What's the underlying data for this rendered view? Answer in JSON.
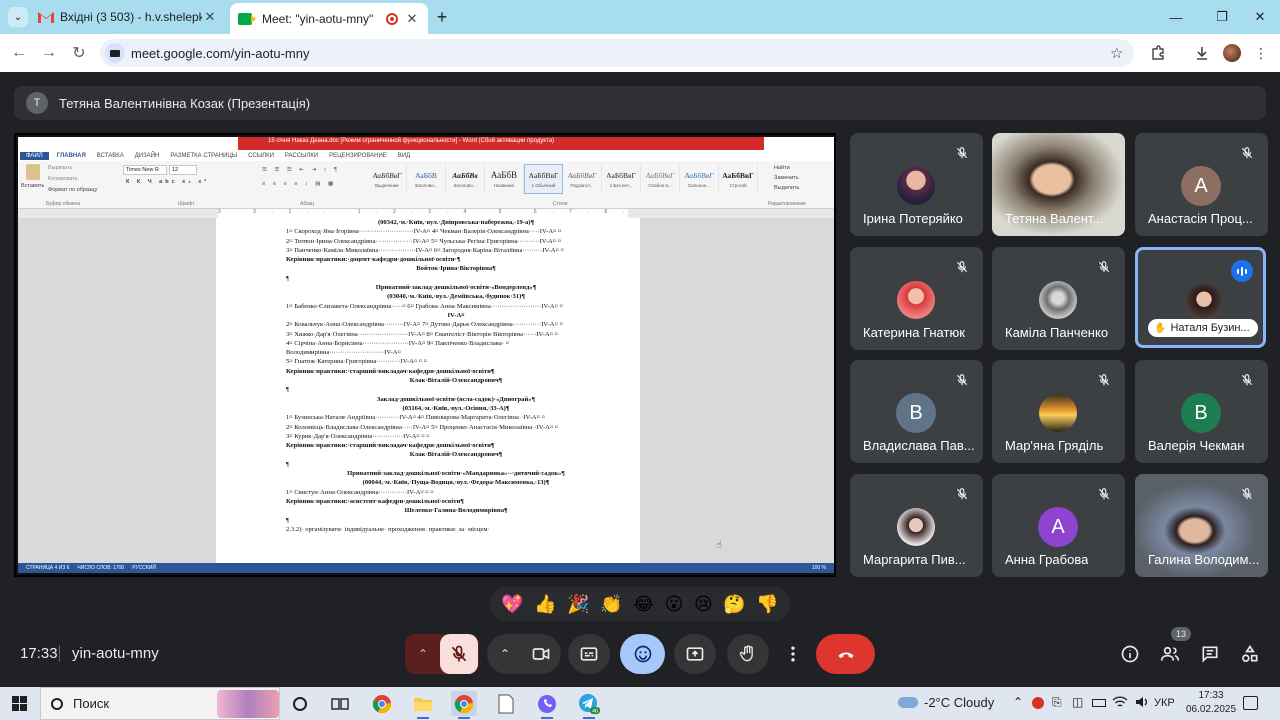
{
  "browser": {
    "tabs": [
      {
        "title": "Вхідні (3 503) - h.v.shelepko@u",
        "active": false,
        "icon": "gmail-icon"
      },
      {
        "title": "Meet: \"yin-aotu-mny\"",
        "active": true,
        "icon": "meet-icon"
      }
    ],
    "url": "meet.google.com/yin-aotu-mny"
  },
  "meet": {
    "presenter_initial": "Т",
    "presenter_label": "Тетяна Валентинівна Козак (Презентація)",
    "time": "17:33",
    "meeting_code": "yin-aotu-mny",
    "participant_count": "13",
    "reactions": [
      "💖",
      "👍",
      "🎉",
      "👏",
      "😂",
      "😮",
      "😢",
      "🤔",
      "👎"
    ],
    "participants": [
      {
        "name": "Ірина Потеряйко",
        "type": "photo",
        "muted": true
      },
      {
        "name": "Тетяна Валент...",
        "type": "video",
        "muted": false
      },
      {
        "name": "Анастасія Проц...",
        "type": "initial",
        "initial": "А",
        "color": "#8d6e63",
        "muted": true
      },
      {
        "name": "Катерина Гнатюк",
        "type": "photo",
        "muted": true
      },
      {
        "name": "Каміла Панченко",
        "type": "photo",
        "muted": true
      },
      {
        "name": "Наталя Бузин...",
        "type": "photo",
        "muted": false,
        "speaking": true
      },
      {
        "name": "Владислава Пав...",
        "type": "initial",
        "initial": "В",
        "color": "#5f7486",
        "muted": true
      },
      {
        "name": "Мар'яна Гряділь",
        "type": "photo",
        "muted": true
      },
      {
        "name": "Валерія Чекман",
        "type": "initial",
        "initial": "В",
        "color": "#1e7d4f",
        "muted": true
      },
      {
        "name": "Маргарита Пив...",
        "type": "photo",
        "muted": true
      },
      {
        "name": "Анна Грабова",
        "type": "initial",
        "initial": "А",
        "color": "#8e44d0",
        "muted": true
      },
      {
        "name": "Галина Володим...",
        "type": "video",
        "muted": true
      }
    ]
  },
  "word": {
    "doc_title": "15 січня Наказ Деана.doc [Режим ограниченной функциональности] - Word (Сбой активации продукта)",
    "tabs": [
      "ФАЙЛ",
      "ГЛАВНАЯ",
      "ВСТАВКА",
      "ДИЗАЙН",
      "РАЗМЕТКА СТРАНИЦЫ",
      "ССЫЛКИ",
      "РАССЫЛКИ",
      "РЕЦЕНЗИРОВАНИЕ",
      "ВИД"
    ],
    "clipboard": {
      "paste": "Вставить",
      "cut": "Вырезать",
      "copy": "Копировать",
      "format": "Формат по образцу",
      "group": "Буфер обмена"
    },
    "font_name": "Times New R",
    "font_size": "12",
    "group_font": "Шрифт",
    "group_paragraph": "Абзац",
    "group_styles": "Стили",
    "group_editing": "Редактирование",
    "editing": [
      "Найти",
      "Заменить",
      "Выделить"
    ],
    "styles": [
      {
        "sample": "АаБбВвГ",
        "name": "Выделение"
      },
      {
        "sample": "АаБбВ",
        "name": "Заголово..."
      },
      {
        "sample": "АаБбВв",
        "name": "Заголово..."
      },
      {
        "sample": "АаБбВ",
        "name": "Название"
      },
      {
        "sample": "АаБбВвГ",
        "name": "1 Обычный"
      },
      {
        "sample": "АаБбВвГ",
        "name": "Подзагол..."
      },
      {
        "sample": "АаБбВвГ",
        "name": "1 Без инт..."
      },
      {
        "sample": "АаБбВвГ",
        "name": "Слабое в..."
      },
      {
        "sample": "АаБбВвГ",
        "name": "Сильное..."
      },
      {
        "sample": "АаБбВвГ",
        "name": "Строгий"
      }
    ],
    "ruler": "3 · 2 · 1 · · · 1 · 2 · 3 · 4 · 5 · 6 · 7 · 8 · 9 · 10 · 11 · 12 · 13 · 14 · 15 · 16 · 17",
    "doc_lines": [
      {
        "t": "(00342,·м.·Київ,·вул.·Дніпровська·набережна,·19-а)¶",
        "s": "c"
      },
      {
        "t": "1¤  Скороход·Яна·Ігорівна·························IV-А¤    4¤   Чекман·Валерія·Олександрівна·····IV-А¤ ¤",
        "s": ""
      },
      {
        "t": "2¤  Тютюн·Ірина·Олександрівна·················IV-А¤    5¤   Чульська·Регіна·Григорівна··········IV-А¤ ¤",
        "s": ""
      },
      {
        "t": "3¤  Панченко·Каміла·Миколаївна·················IV-А¤    6¤   Загородня·Каріна·Віталіївна·········IV-А¤ ¤",
        "s": ""
      },
      {
        "t": "Керівник·практики:·доцент·кафедри·дошкільної·освіти·¶",
        "s": "b"
      },
      {
        "t": "Войток·Ірина·Вікторівна¶",
        "s": "c"
      },
      {
        "t": "¶",
        "s": ""
      },
      {
        "t": "Приватний·заклад·дошкільної·освіти·«Вондерленд»¶",
        "s": "c"
      },
      {
        "t": "(03040,·м.·Київ,·вул.·Деміївська,·будинок·31)¶",
        "s": "c"
      },
      {
        "t": "1¤  Бабенко·Єлизавета·Олександрівна·····¤    6¤   Грабова·Анна·Максимівна·······················IV-А¤ ¤",
        "s": ""
      },
      {
        "t": "IV-А¤",
        "s": "c"
      },
      {
        "t": "2¤  Ковальчук·Анна·Олександрівна·········IV-А¤    7¤   Дутова·Дарья·Олександрівна·············IV-А¤ ¤",
        "s": ""
      },
      {
        "t": "3¤  Хижко·Дар'я·Олегівна·······················IV-А¤    8¤   Євангеліст·Вікторія·Вікторівна······IV-А¤ ¤",
        "s": ""
      },
      {
        "t": "4¤  Сірчіна·Анна·Борисівна·····················IV-А¤    9¤   Павліченко·Владислава·                          ¤",
        "s": ""
      },
      {
        "t": "                                                                     Володимирівна·························IV-А¤",
        "s": ""
      },
      {
        "t": "5¤  Гнатюк·Катерина·Григорівна···········IV-А¤   ¤        ¤",
        "s": ""
      },
      {
        "t": "Керівник·практики:·старший·викладач·кафедри·дошкільної·освіти¶",
        "s": "b"
      },
      {
        "t": "Клак·Віталій·Олександрович¶",
        "s": "c"
      },
      {
        "t": "¶",
        "s": ""
      },
      {
        "t": "Заклад·дошкільної·освіти·(ясла-садок)·«Двиограй»¶",
        "s": "c"
      },
      {
        "t": "(03164,·м.·Київ,·вул.·Осіння,·33-А)¶",
        "s": "c"
      },
      {
        "t": "1¤  Бузинська·Наталя·Андріївна···········IV-А¤    4¤   Пивоварова·Маргарита·Олегівна··IV-А¤ ¤",
        "s": ""
      },
      {
        "t": "2¤  Коломієць·Владислава·Олександрівна·····IV-А¤    5¤   Проценко·Анастасія·Миколаївна··IV-А¤ ¤",
        "s": ""
      },
      {
        "t": "3¤  Курик·Дар'я·Олександрівна··············IV-А¤   ¤        ¤",
        "s": ""
      },
      {
        "t": "Керівник·практики:·старший·викладач·кафедри·дошкільної·освіти¶",
        "s": "b"
      },
      {
        "t": "Клак·Віталій·Олександрович¶",
        "s": "c"
      },
      {
        "t": "¶",
        "s": ""
      },
      {
        "t": "Приватний·заклад·дошкільної·освіти·«Мандаринка»·-·дитячий·садок»¶",
        "s": "c"
      },
      {
        "t": "(00044,·м.·Київ,·Пуща-Водиця,·вул.·Федора·Максименка,·13)¶",
        "s": "c"
      },
      {
        "t": "1¤  Свистун·Анна·Олександрівна·············IV-А¤   ¤        ¤",
        "s": ""
      },
      {
        "t": "Керівник·практики:·асистент·кафедри·дошкільної·освіти¶",
        "s": "b"
      },
      {
        "t": "Шелепко·Галина·Володимирівна¶",
        "s": "c"
      },
      {
        "t": "¶",
        "s": ""
      },
      {
        "t": "      2.3.2)·  організувати·  індивідуальне·  проходження·  практики·  за·  місцем·",
        "s": ""
      }
    ],
    "status_page": "СТРАНИЦА 4 ИЗ 6",
    "status_words": "ЧИСЛО СЛОВ: 1700",
    "status_lang": "РУССКИЙ",
    "zoom": "100 %"
  },
  "taskbar": {
    "search_placeholder": "Поиск",
    "weather": "-2°C  Cloudy",
    "lang": "УКР",
    "time": "17:33",
    "date": "06.02.2025",
    "telegram_badge": "46"
  }
}
